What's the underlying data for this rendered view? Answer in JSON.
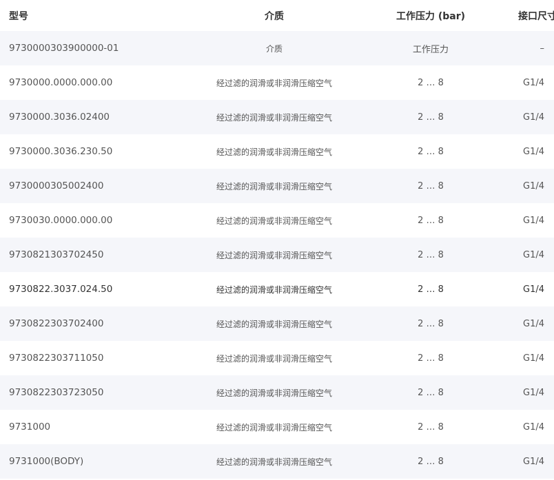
{
  "header": {
    "model": "型号",
    "medium": "介质",
    "pressure": "工作压力 (bar)",
    "port": "接口尺寸"
  },
  "rows": [
    {
      "model": "9730000303900000-01",
      "medium": "介质",
      "pressure": "工作压力",
      "port": "–"
    },
    {
      "model": "9730000.0000.000.00",
      "medium": "经过滤的润滑或非润滑压缩空气",
      "pressure": "2 … 8",
      "port": "G1/4"
    },
    {
      "model": "9730000.3036.02400",
      "medium": "经过滤的润滑或非润滑压缩空气",
      "pressure": "2 … 8",
      "port": "G1/4"
    },
    {
      "model": "9730000.3036.230.50",
      "medium": "经过滤的润滑或非润滑压缩空气",
      "pressure": "2 … 8",
      "port": "G1/4"
    },
    {
      "model": "9730000305002400",
      "medium": "经过滤的润滑或非润滑压缩空气",
      "pressure": "2 … 8",
      "port": "G1/4"
    },
    {
      "model": "9730030.0000.000.00",
      "medium": "经过滤的润滑或非润滑压缩空气",
      "pressure": "2 … 8",
      "port": "G1/4"
    },
    {
      "model": "9730821303702450",
      "medium": "经过滤的润滑或非润滑压缩空气",
      "pressure": "2 … 8",
      "port": "G1/4"
    },
    {
      "model": "9730822.3037.024.50",
      "medium": "经过滤的润滑或非润滑压缩空气",
      "pressure": "2 … 8",
      "port": "G1/4"
    },
    {
      "model": "9730822303702400",
      "medium": "经过滤的润滑或非润滑压缩空气",
      "pressure": "2 … 8",
      "port": "G1/4"
    },
    {
      "model": "9730822303711050",
      "medium": "经过滤的润滑或非润滑压缩空气",
      "pressure": "2 … 8",
      "port": "G1/4"
    },
    {
      "model": "9730822303723050",
      "medium": "经过滤的润滑或非润滑压缩空气",
      "pressure": "2 … 8",
      "port": "G1/4"
    },
    {
      "model": "9731000",
      "medium": "经过滤的润滑或非润滑压缩空气",
      "pressure": "2 … 8",
      "port": "G1/4"
    },
    {
      "model": "9731000(BODY)",
      "medium": "经过滤的润滑或非润滑压缩空气",
      "pressure": "2 … 8",
      "port": "G1/4"
    }
  ]
}
